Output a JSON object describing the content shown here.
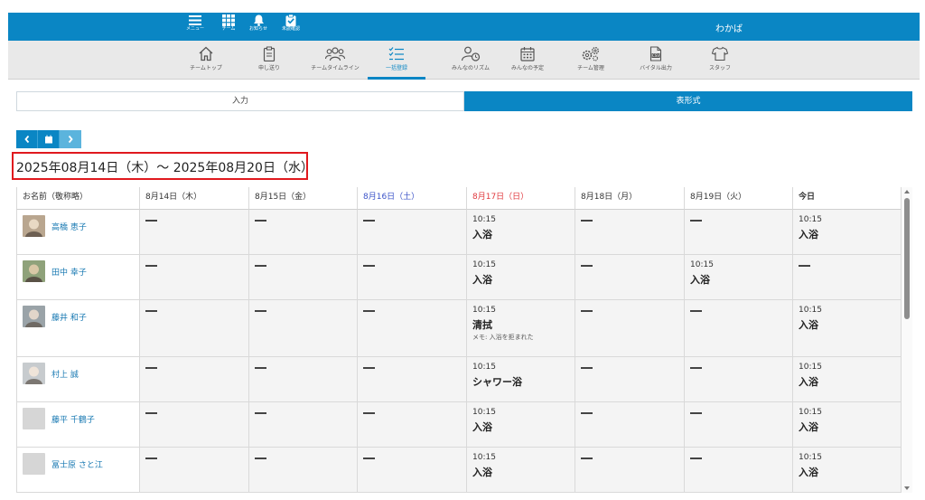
{
  "topbar": {
    "facility_name": "わかば",
    "icons": [
      {
        "label": "メニュー",
        "icon": "hamburger-icon"
      },
      {
        "label": "チーム",
        "icon": "grid-icon"
      },
      {
        "label": "お知らせ",
        "icon": "bell-icon"
      },
      {
        "label": "未読確認",
        "icon": "clipboard-check-icon"
      }
    ]
  },
  "nav": {
    "items": [
      {
        "label": "チームトップ",
        "icon": "home-icon"
      },
      {
        "label": "申し送り",
        "icon": "clipboard-icon"
      },
      {
        "label": "チームタイムライン",
        "icon": "people-icon"
      },
      {
        "label": "一括登録",
        "icon": "checklist-icon",
        "active": true
      },
      {
        "label": "みんなのリズム",
        "icon": "person-clock-icon"
      },
      {
        "label": "みんなの予定",
        "icon": "calendar-icon"
      },
      {
        "label": "チーム管理",
        "icon": "gears-icon"
      },
      {
        "label": "バイタル出力",
        "icon": "csv-icon"
      },
      {
        "label": "スタッフ",
        "icon": "shirt-icon"
      }
    ]
  },
  "tabs": {
    "input": "入力",
    "table": "表形式"
  },
  "date_range": "2025年08月14日（木）～ 2025年08月20日（水）",
  "table": {
    "headers": [
      "お名前（敬称略）",
      "8月14日（木）",
      "8月15日（金）",
      "8月16日（土）",
      "8月17日（日）",
      "8月18日（月）",
      "8月19日（火）",
      "今日"
    ],
    "rows": [
      {
        "name": "高橋 恵子",
        "avatar": "photo",
        "cells": [
          null,
          null,
          null,
          {
            "time": "10:15",
            "event": "入浴"
          },
          null,
          null,
          {
            "time": "10:15",
            "event": "入浴"
          }
        ]
      },
      {
        "name": "田中 幸子",
        "avatar": "photo",
        "cells": [
          null,
          null,
          null,
          {
            "time": "10:15",
            "event": "入浴"
          },
          null,
          {
            "time": "10:15",
            "event": "入浴"
          },
          null
        ]
      },
      {
        "name": "藤井 和子",
        "avatar": "photo",
        "cells": [
          null,
          null,
          null,
          {
            "time": "10:15",
            "event": "清拭",
            "memo": "メモ: 入浴を拒まれた"
          },
          null,
          null,
          {
            "time": "10:15",
            "event": "入浴"
          }
        ]
      },
      {
        "name": "村上 誠",
        "avatar": "photo",
        "cells": [
          null,
          null,
          null,
          {
            "time": "10:15",
            "event": "シャワー浴"
          },
          null,
          null,
          {
            "time": "10:15",
            "event": "入浴"
          }
        ]
      },
      {
        "name": "藤平 千鶴子",
        "avatar": "placeholder",
        "cells": [
          null,
          null,
          null,
          {
            "time": "10:15",
            "event": "入浴"
          },
          null,
          null,
          {
            "time": "10:15",
            "event": "入浴"
          }
        ]
      },
      {
        "name": "冨士原 さと江",
        "avatar": "placeholder",
        "cells": [
          null,
          null,
          null,
          {
            "time": "10:15",
            "event": "入浴"
          },
          null,
          null,
          {
            "time": "10:15",
            "event": "入浴"
          }
        ]
      }
    ]
  },
  "colors": {
    "primary": "#0a86c4",
    "saturday": "#3b53c8",
    "sunday": "#e0393e",
    "highlight_box": "#e0191e"
  }
}
